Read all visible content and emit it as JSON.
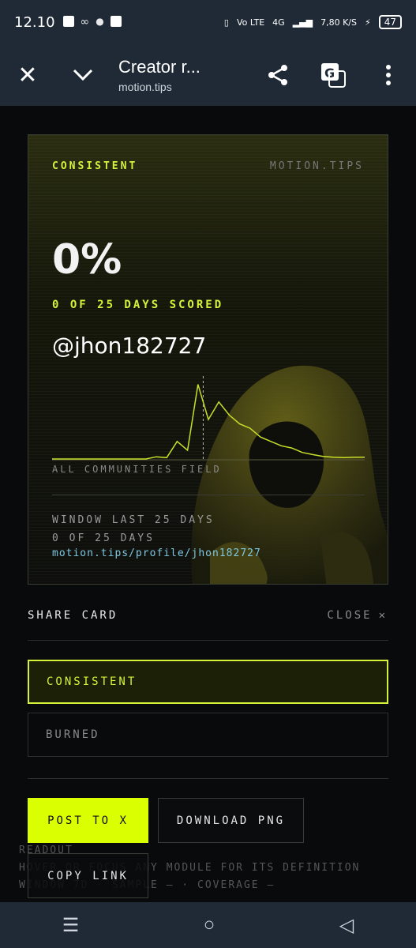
{
  "status_bar": {
    "time": "12.10",
    "net_speed": "7,80 K/S",
    "battery": "47",
    "net_labels": [
      "Vo LTE",
      "4G"
    ]
  },
  "toolbar": {
    "title": "Creator r...",
    "url": "motion.tips"
  },
  "background": {
    "readout_title": "READOUT",
    "readout_hint": "HOVER OR FOCUS ANY MODULE FOR ITS DEFINITION",
    "readout_stats": "WINDOW 7D · SAMPLE — · COVERAGE —"
  },
  "card": {
    "tag": "CONSISTENT",
    "site": "MOTION.TIPS",
    "percent": "0%",
    "days_scored": "0 OF 25 DAYS SCORED",
    "username": "@jhon182727",
    "field_label": "ALL COMMUNITIES FIELD",
    "window": "WINDOW LAST 25 DAYS",
    "days": "0 OF 25 DAYS",
    "profile_link": "motion.tips/profile/jhon182727"
  },
  "share": {
    "heading": "SHARE CARD",
    "close_label": "CLOSE",
    "options": [
      "CONSISTENT",
      "BURNED"
    ],
    "selected": "CONSISTENT",
    "post_label": "POST TO X",
    "download_label": "DOWNLOAD PNG",
    "copy_label": "COPY LINK"
  },
  "colors": {
    "accent": "#d9ff00",
    "link": "#7ec8e0",
    "bar": "#1f2a36"
  },
  "chart_data": {
    "type": "line",
    "title": "",
    "x": [
      0,
      1,
      2,
      3,
      4,
      5,
      6,
      7,
      8,
      9,
      10,
      11,
      12,
      13,
      14,
      15,
      16,
      17,
      18,
      19,
      20,
      21,
      22,
      23,
      24,
      25,
      26,
      27,
      28,
      29,
      30
    ],
    "values": [
      0,
      0,
      0,
      0,
      0,
      0,
      0,
      0,
      0,
      0,
      0.5,
      0.3,
      4,
      2,
      17,
      9,
      13,
      10,
      8,
      7,
      5,
      4,
      3,
      2.5,
      1.5,
      1,
      0.6,
      0.4,
      0.3,
      0.4,
      0.4
    ],
    "marker_x": 14.5,
    "ylim": [
      0,
      18
    ]
  }
}
